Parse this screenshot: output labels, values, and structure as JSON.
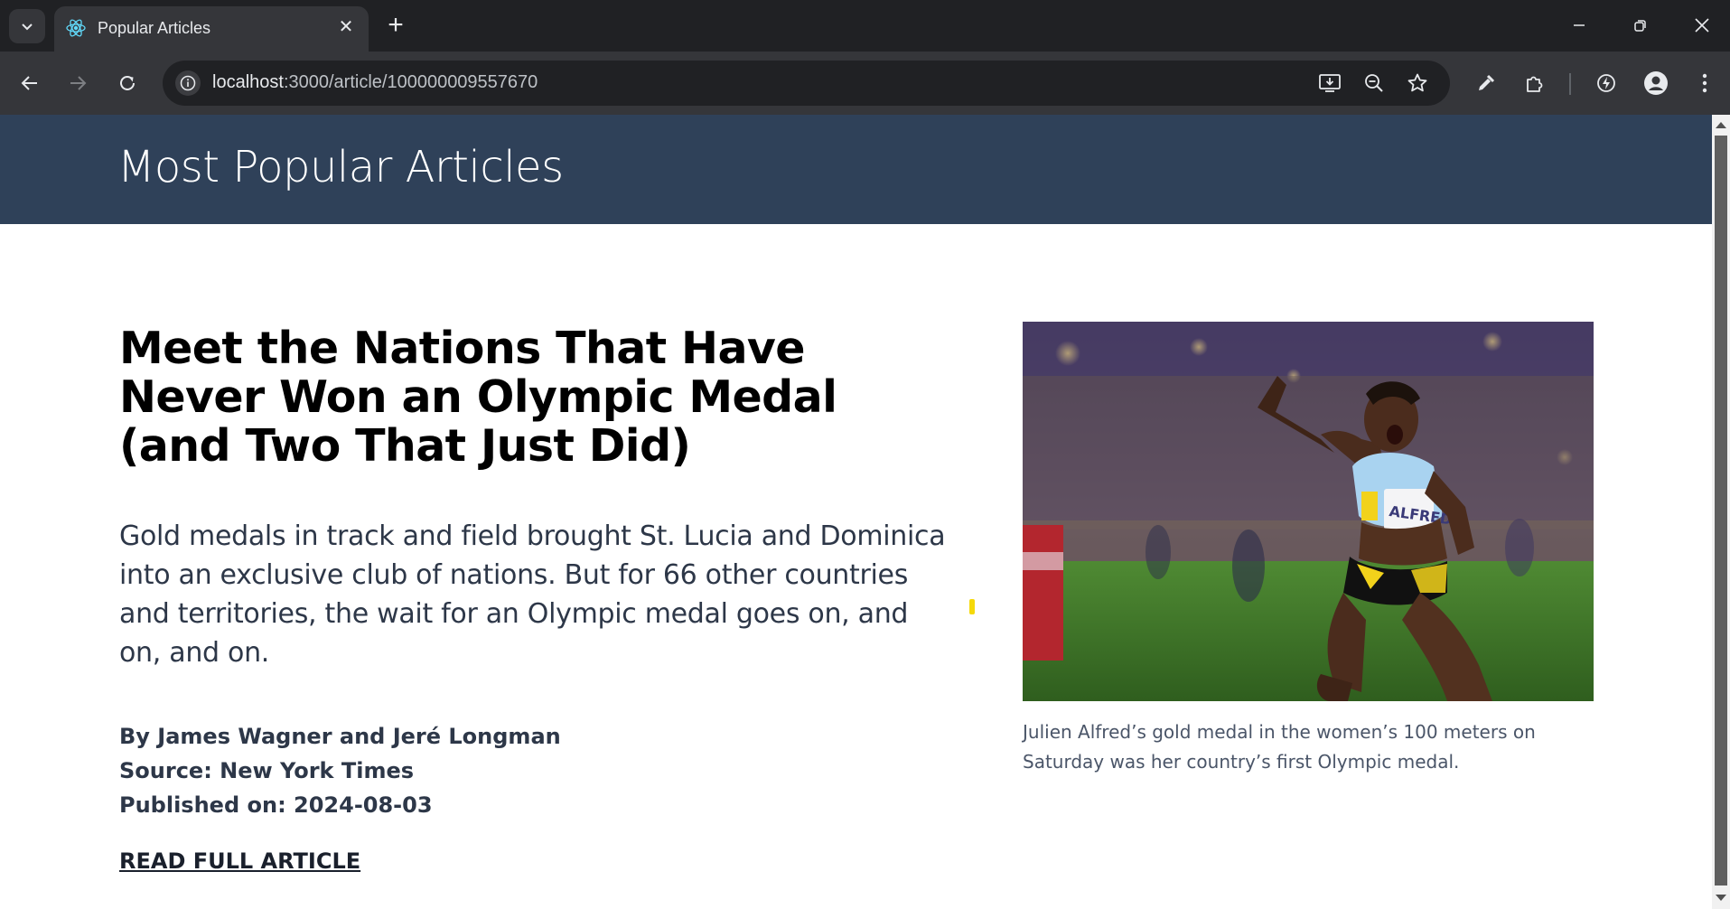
{
  "browser": {
    "tab_title": "Popular Articles",
    "url_host": "localhost",
    "url_path": ":3000/article/100000009557670"
  },
  "icons": {
    "tab_search": "chevron-down-icon",
    "favicon": "react-icon",
    "tab_close": "close-icon",
    "new_tab": "plus-icon",
    "back": "arrow-left-icon",
    "forward": "arrow-right-icon",
    "reload": "reload-icon",
    "site_info": "info-icon",
    "install": "install-icon",
    "zoom": "zoom-out-icon",
    "bookmark": "star-icon",
    "eyedropper": "eyedropper-icon",
    "extensions": "puzzle-icon",
    "performance": "performance-icon",
    "profile": "profile-icon",
    "menu": "kebab-menu-icon"
  },
  "site": {
    "title": "Most Popular Articles"
  },
  "article": {
    "title": "Meet the Nations That Have Never Won an Olympic Medal (and Two That Just Did)",
    "abstract": "Gold medals in track and field brought St. Lucia and Dominica into an exclusive club of nations. But for 66 other countries and territories, the wait for an Olympic medal goes on, and on, and on.",
    "byline": "By James Wagner and Jeré Longman",
    "source": "Source: New York Times",
    "published": "Published on: 2024-08-03",
    "read_more": "READ FULL ARTICLE",
    "image_caption": "Julien Alfred’s gold medal in the women’s 100 meters on Saturday was her country’s first Olympic medal.",
    "bib_text": "ALFRED"
  },
  "colors": {
    "header_bg": "#2f4159",
    "chrome_dark": "#202124",
    "chrome_toolbar": "#35363a",
    "text_body": "#2d3748"
  }
}
